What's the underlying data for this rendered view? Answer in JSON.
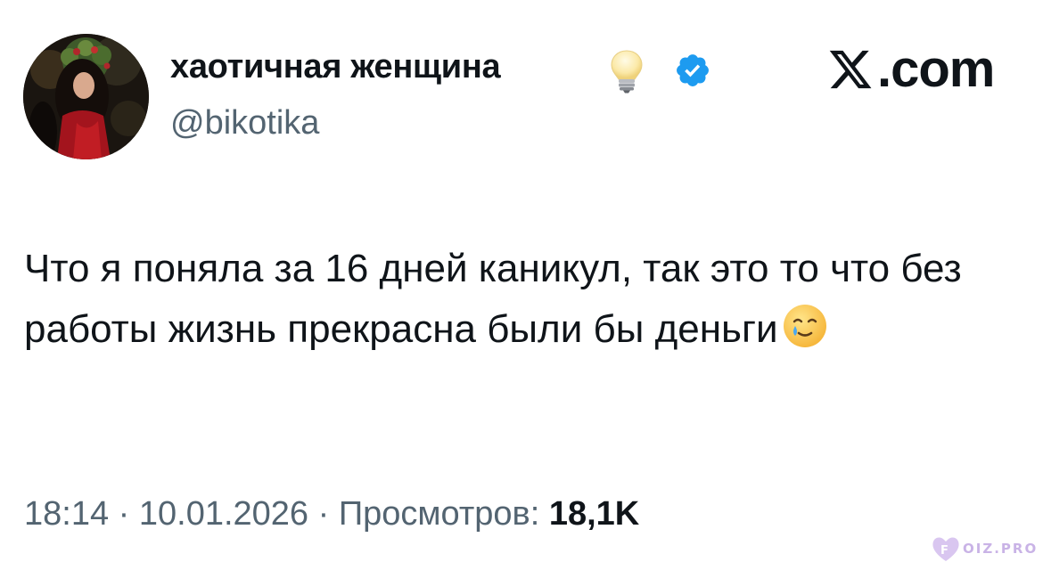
{
  "author": {
    "display_name": "хаотичная женщина",
    "handle": "@bikotika",
    "avatar_icon": "profile-photo",
    "emoji_icon": "light-bulb-icon",
    "verified_icon": "verified-badge-icon",
    "verified_color": "#1d9bf0"
  },
  "brand": {
    "text": ".com",
    "logo_icon": "x-logo-icon"
  },
  "tweet": {
    "text": "Что я поняла за 16 дней каникул, так это то что без работы жизнь прекрасна были бы деньги",
    "trailing_emoji": "smiling-face-with-tear-emoji"
  },
  "meta": {
    "time": "18:14",
    "separator": "·",
    "date": "10.01.2026",
    "views_label": "Просмотров:",
    "views_count": "18,1K"
  },
  "watermark": {
    "text": "OIZ.PRO",
    "color": "#c9b3e6"
  },
  "colors": {
    "text_primary": "#0f1419",
    "text_secondary": "#536471",
    "background": "#ffffff"
  }
}
